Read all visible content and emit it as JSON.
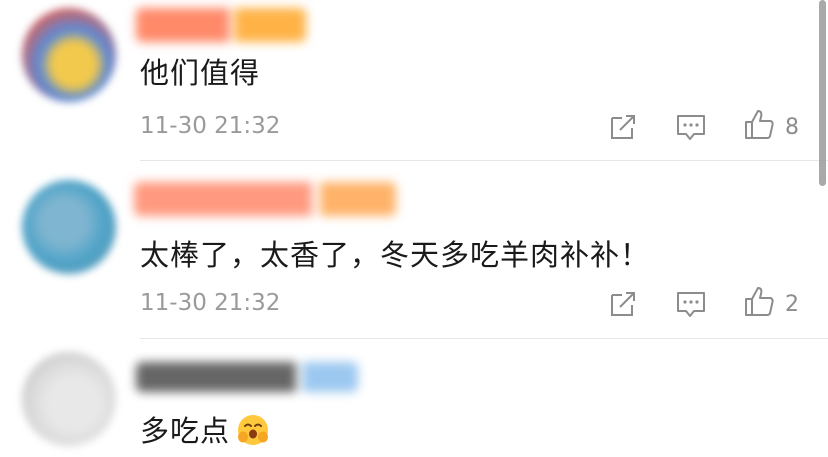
{
  "comments": [
    {
      "text": "他们值得",
      "time": "11-30 21:32",
      "like_count": "8",
      "colors": {
        "avatar": [
          "#f2c94c",
          "#5a8ad8",
          "#e85a4a"
        ],
        "name": [
          "#ff8a6a",
          "#ffb347"
        ]
      }
    },
    {
      "text": "太棒了，太香了，冬天多吃羊肉补补！",
      "time": "11-30 21:32",
      "like_count": "2",
      "colors": {
        "avatar": [
          "#4fa3c8",
          "#7fb5d0",
          "#5c9ab5"
        ],
        "name": [
          "#ff9a80",
          "#ffb36a"
        ]
      }
    },
    {
      "text": "多吃点",
      "emoji": "smiling-face-with-hands-emoji",
      "colors": {
        "avatar": [
          "#d9d9d9",
          "#bfbfbf",
          "#e8e8e8"
        ],
        "name": [
          "#555555",
          "#9cc8f0"
        ]
      }
    }
  ],
  "icons": {
    "share": "share-icon",
    "reply": "comment-icon",
    "like": "thumbs-up-icon"
  }
}
